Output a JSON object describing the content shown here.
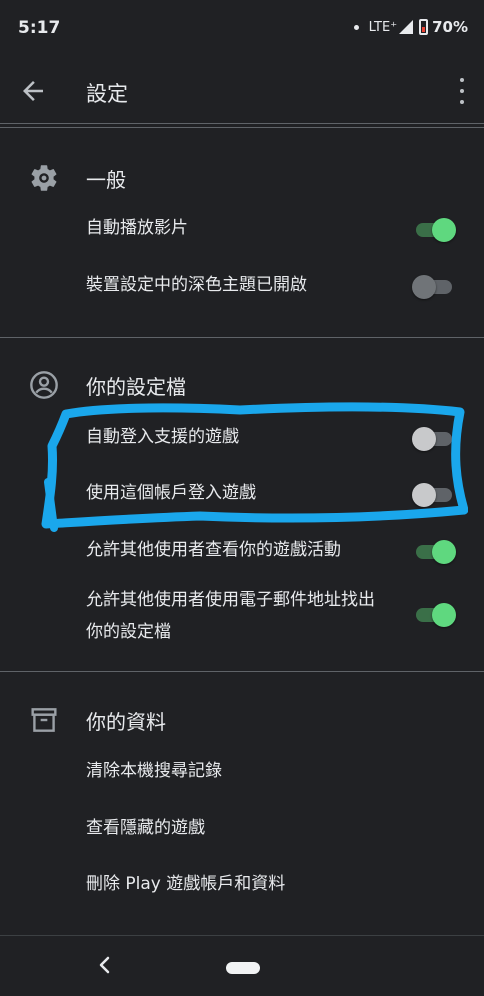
{
  "status_bar": {
    "time": "5:17",
    "network": "LTE⁺",
    "battery": "70%"
  },
  "app_bar": {
    "title": "設定",
    "back_icon": "arrow-back-icon",
    "more_icon": "more-vert-icon"
  },
  "sections": {
    "general": {
      "title": "一般",
      "icon": "gear-icon",
      "rows": [
        {
          "label": "自動播放影片",
          "toggle": true
        },
        {
          "label": "裝置設定中的深色主題已開啟",
          "toggle": false
        }
      ]
    },
    "profile": {
      "title": "你的設定檔",
      "icon": "account-circle-icon",
      "rows": [
        {
          "label": "自動登入支援的遊戲",
          "toggle": false
        },
        {
          "label": "使用這個帳戶登入遊戲",
          "toggle": false
        },
        {
          "label": "允許其他使用者查看你的遊戲活動",
          "toggle": true
        },
        {
          "label": "允許其他使用者使用電子郵件地址找出你的設定檔",
          "toggle": true
        }
      ]
    },
    "data": {
      "title": "你的資料",
      "icon": "archive-icon",
      "rows": [
        {
          "label": "清除本機搜尋記錄"
        },
        {
          "label": "查看隱藏的遊戲"
        },
        {
          "label": "刪除 Play 遊戲帳戶和資料"
        }
      ]
    }
  },
  "colors": {
    "background": "#202124",
    "toggle_on": "#5fd87f",
    "annotation": "#1aa7ec"
  }
}
